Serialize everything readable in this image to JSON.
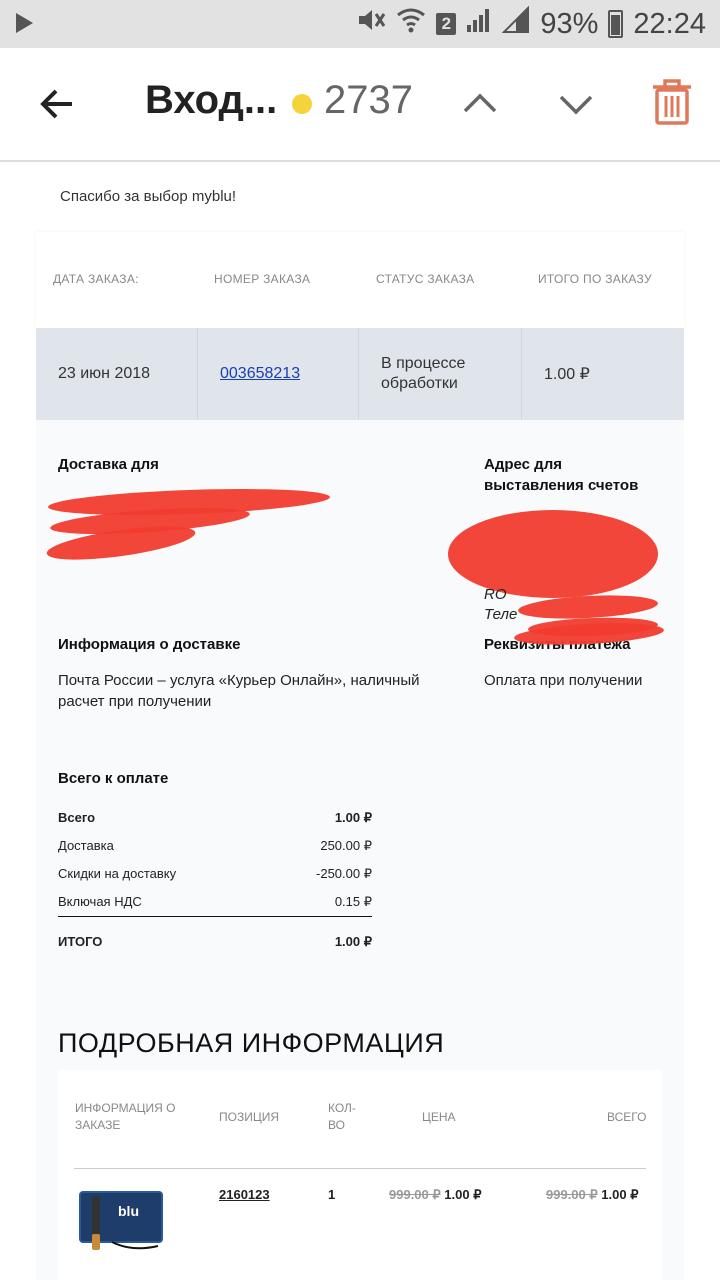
{
  "status_bar": {
    "battery": "93%",
    "time": "22:24",
    "sim_slot": "2"
  },
  "app_bar": {
    "title": "Вход...",
    "count": "2737"
  },
  "email": {
    "greeting": "Спасибо за выбор myblu!",
    "order_header": {
      "date_label": "ДАТА ЗАКАЗА:",
      "number_label": "НОМЕР ЗАКАЗА",
      "status_label": "СТАТУС ЗАКАЗА",
      "total_label": "ИТОГО ПО ЗАКАЗУ"
    },
    "order": {
      "date": "23 июн 2018",
      "number": "003658213",
      "status_line1": "В процессе",
      "status_line2": "обработки",
      "total": "1.00 ₽"
    },
    "delivery_for_label": "Доставка для",
    "billing_address_label_line1": "Адрес для",
    "billing_address_label_line2": "выставления счетов",
    "billing_visible_country": "RO",
    "billing_visible_phone": "Теле",
    "delivery_info_label": "Информация о доставке",
    "delivery_info_line1": "Почта России – услуга «Курьер Онлайн», наличный",
    "delivery_info_line2": "расчет при получении",
    "payment_label": "Реквизиты платежа",
    "payment_value": "Оплата при получении",
    "totals_label": "Всего к оплате",
    "totals": [
      {
        "label": "Всего",
        "value": "1.00 ₽"
      },
      {
        "label": "Доставка",
        "value": "250.00 ₽"
      },
      {
        "label": "Скидки на доставку",
        "value": "-250.00 ₽"
      },
      {
        "label": "Включая НДС",
        "value": "0.15 ₽"
      },
      {
        "label": "ИТОГО",
        "value": "1.00 ₽"
      }
    ],
    "details_title": "ПОДРОБНАЯ ИНФОРМАЦИЯ",
    "details_headers": {
      "info_line1": "ИНФОРМАЦИЯ О",
      "info_line2": "ЗАКАЗЕ",
      "position": "ПОЗИЦИЯ",
      "qty_line1": "КОЛ-",
      "qty_line2": "ВО",
      "price": "ЦЕНА",
      "total": "ВСЕГО"
    },
    "item": {
      "product_image": "myblu-starter-kit",
      "sku": "2160123",
      "qty": "1",
      "old_price": "999.00 ₽",
      "price": "1.00 ₽",
      "old_total": "999.00 ₽",
      "total": "1.00 ₽"
    }
  },
  "colors": {
    "accent_dot": "#f5d43b",
    "trash": "#e0795a",
    "link": "#1a3fb3",
    "redaction": "#f03c2e"
  }
}
